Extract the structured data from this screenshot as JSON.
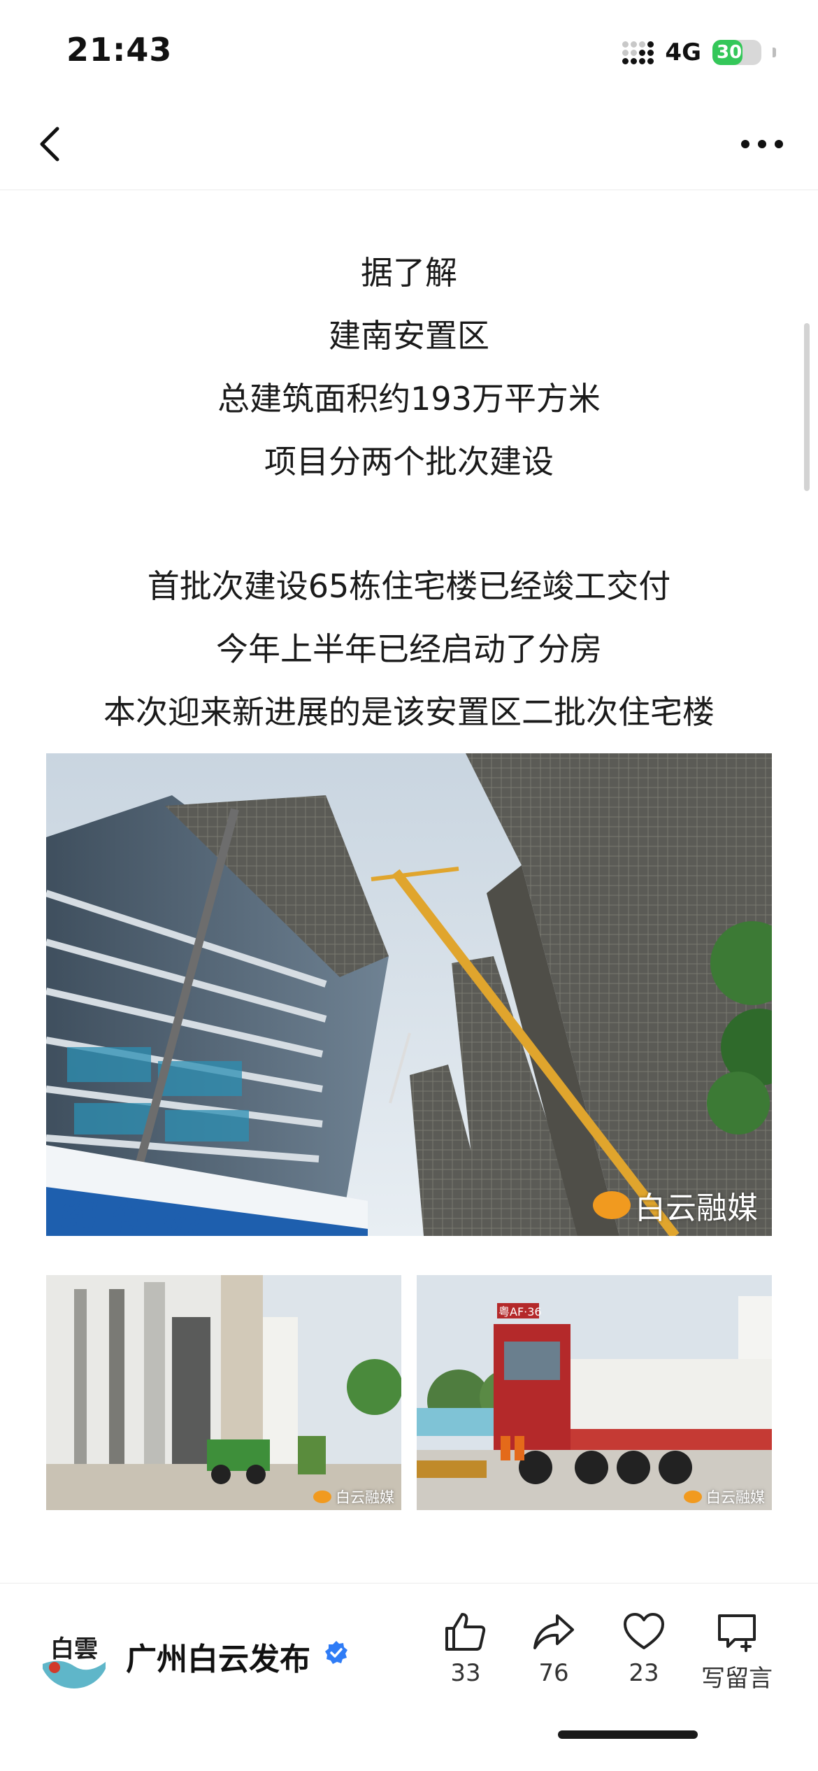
{
  "status_bar": {
    "time": "21:43",
    "network": "4G",
    "battery": "30",
    "battery_color": "#34c759"
  },
  "nav": {
    "back_icon": "chevron-left-icon",
    "more_icon": "more-horizontal-icon"
  },
  "article": {
    "intro_lines": [
      "据了解",
      "建南安置区",
      "总建筑面积约193万平方米",
      "项目分两个批次建设"
    ],
    "progress_lines": [
      "首批次建设65栋住宅楼已经竣工交付",
      "今年上半年已经启动了分房",
      "本次迎来新进展的是该安置区二批次住宅楼"
    ],
    "main_photo": {
      "description_icon": "construction-photo",
      "watermark": "白云融媒"
    },
    "photo_1": {
      "watermark": "白云融媒"
    },
    "photo_2": {
      "watermark": "白云融媒",
      "truck_plate": "粤AF·36"
    }
  },
  "bottom_bar": {
    "account_name": "广州白云发布",
    "avatar_text": "白雲",
    "verified_icon": "verified-badge-icon",
    "verified_color": "#2f7cf6",
    "like_count": "33",
    "share_count": "76",
    "favorite_count": "23",
    "comment_label": "写留言"
  }
}
